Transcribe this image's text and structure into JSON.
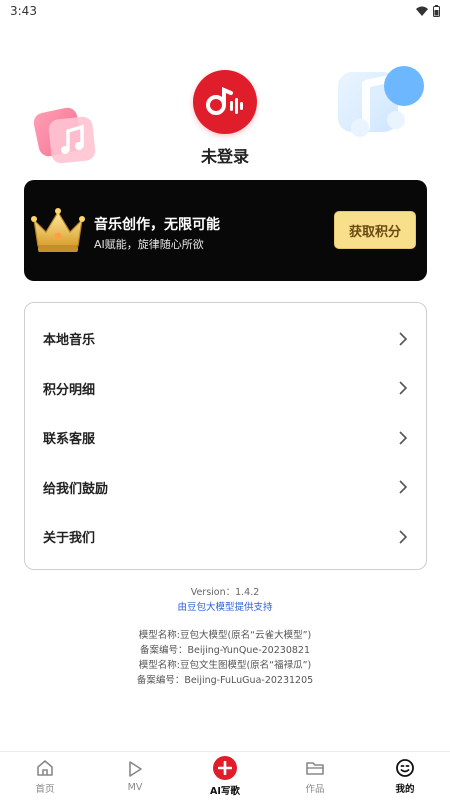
{
  "status_bar": {
    "time": "3:43"
  },
  "profile": {
    "login_label": "未登录"
  },
  "promo": {
    "title": "音乐创作，无限可能",
    "subtitle": "AI赋能，旋律随心所欲",
    "button_label": "获取积分"
  },
  "menu": {
    "items": [
      {
        "label": "本地音乐"
      },
      {
        "label": "积分明细"
      },
      {
        "label": "联系客服"
      },
      {
        "label": "给我们鼓励"
      },
      {
        "label": "关于我们"
      }
    ]
  },
  "footer": {
    "version": "Version：1.4.2",
    "support_link": "由豆包大模型提供支持",
    "model_name_1": "模型名称:豆包大模型(原名“云雀大模型”)",
    "record_no_1": "备案编号：Beijing-YunQue-20230821",
    "model_name_2": "模型名称:豆包文生图模型(原名“福禄瓜”)",
    "record_no_2": "备案编号：Beijing-FuLuGua-20231205"
  },
  "tabs": [
    {
      "label": "首页"
    },
    {
      "label": "MV"
    },
    {
      "label": "AI写歌"
    },
    {
      "label": "作品"
    },
    {
      "label": "我的"
    }
  ],
  "colors": {
    "brand_red": "#e01e2b",
    "promo_bg": "#080808",
    "points_button": "#f7df8c",
    "link_blue": "#2b5fd9"
  }
}
